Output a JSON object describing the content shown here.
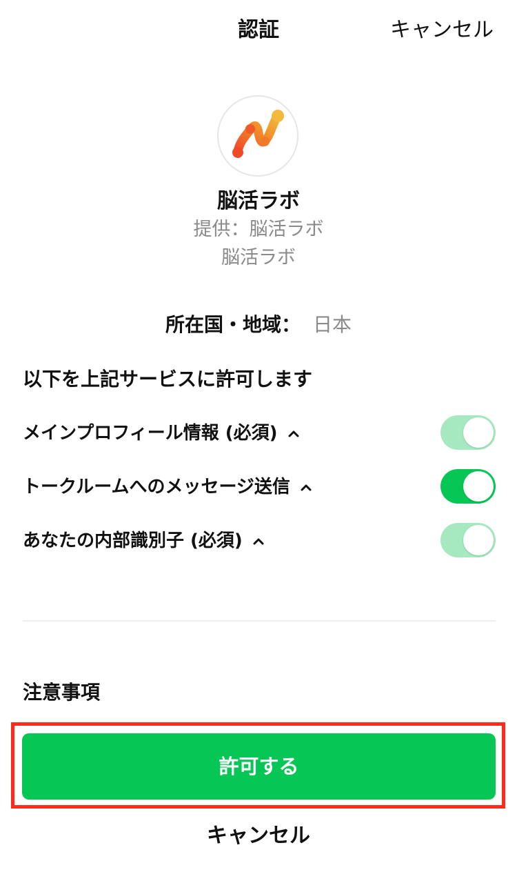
{
  "header": {
    "title": "認証",
    "cancel_label": "キャンセル"
  },
  "app": {
    "logo_icon": "neuron-network-icon",
    "name": "脳活ラボ",
    "provider": "提供：脳活ラボ",
    "subtitle": "脳活ラボ"
  },
  "region": {
    "label": "所在国・地域：",
    "value": "日本"
  },
  "permissions": {
    "heading": "以下を上記サービスに許可します",
    "items": [
      {
        "label": "メインプロフィール情報 (必須)",
        "state": "disabled-on"
      },
      {
        "label": "トークルームへのメッセージ送信",
        "state": "on"
      },
      {
        "label": "あなたの内部識別子 (必須)",
        "state": "disabled-on"
      }
    ]
  },
  "notes": {
    "label": "注意事項"
  },
  "actions": {
    "allow_label": "許可する",
    "cancel_label": "キャンセル"
  },
  "colors": {
    "accent": "#06c755",
    "accent_disabled": "#a6e8bf",
    "highlight": "#ff2a1a",
    "muted_text": "#8a8a8a"
  }
}
